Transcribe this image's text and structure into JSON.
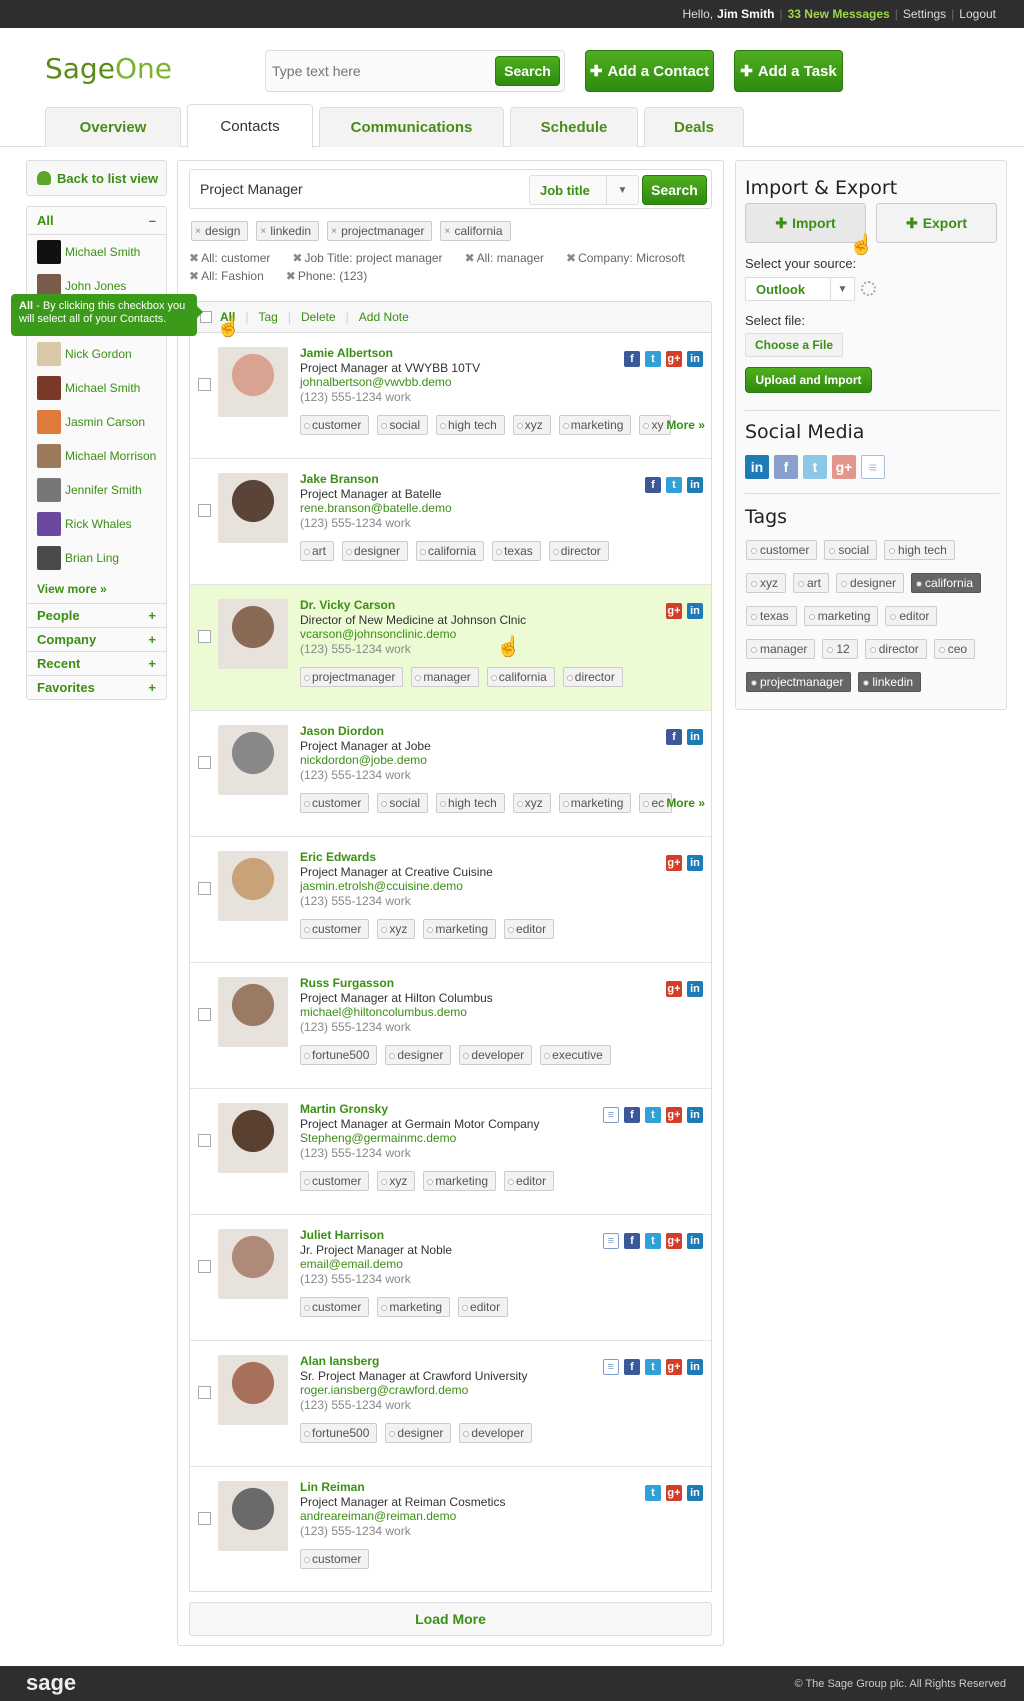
{
  "topbar": {
    "hello": "Hello,",
    "user": "Jim Smith",
    "messages": "33 New Messages",
    "settings": "Settings",
    "logout": "Logout"
  },
  "header": {
    "logo_sage": "Sage",
    "logo_one": "One",
    "search_placeholder": "Type text here",
    "search_button": "Search",
    "add_contact": "Add a Contact",
    "add_task": "Add a Task"
  },
  "tabs": [
    "Overview",
    "Contacts",
    "Communications",
    "Schedule",
    "Deals"
  ],
  "sidebar": {
    "back": "Back to list view",
    "all_label": "All",
    "all_toggle": "–",
    "contacts": [
      {
        "name": "Michael Smith",
        "color": "#111"
      },
      {
        "name": "John Jones",
        "color": "#7a5a4a"
      },
      {
        "name": "",
        "color": "#4a8c17"
      },
      {
        "name": "Nick Gordon",
        "color": "#d7c9a5"
      },
      {
        "name": "Michael Smith",
        "color": "#7a3a2a"
      },
      {
        "name": "Jasmin Carson",
        "color": "#e07a3a"
      },
      {
        "name": "Michael Morrison",
        "color": "#9a7a5a"
      },
      {
        "name": "Jennifer Smith",
        "color": "#777"
      },
      {
        "name": "Rick Whales",
        "color": "#6a4aa0"
      },
      {
        "name": "Brian Ling",
        "color": "#4a4a4a"
      }
    ],
    "view_more": "View more »",
    "categories": [
      {
        "label": "People",
        "sign": "+"
      },
      {
        "label": "Company",
        "sign": "+"
      },
      {
        "label": "Recent",
        "sign": "+"
      },
      {
        "label": "Favorites",
        "sign": "+"
      }
    ],
    "tooltip_bold": "All",
    "tooltip_text": " - By clicking this checkbox you will select all of your Contacts."
  },
  "main": {
    "query": "Project Manager",
    "field": "Job title",
    "search": "Search",
    "filter_tags": [
      "design",
      "linkedin",
      "projectmanager",
      "california"
    ],
    "filters": [
      "All: customer",
      "Job Title: project manager",
      "All: manager",
      "Company: Microsoft",
      "All: Fashion",
      "Phone: (123)"
    ],
    "actions": {
      "all": "All",
      "tag": "Tag",
      "delete": "Delete",
      "note": "Add Note"
    },
    "load_more": "Load More"
  },
  "contacts": [
    {
      "name": "Jamie Albertson",
      "role": "Project Manager",
      "at": "at",
      "company": "VWYBB 10TV",
      "email": "johnalbertson@vwvbb.demo",
      "phone": "(123) 555-1234 work",
      "tags": [
        "customer",
        "social",
        "high tech",
        "xyz",
        "marketing",
        "xy"
      ],
      "more": "More »",
      "social": [
        "fb",
        "tw",
        "gp",
        "li"
      ],
      "photo": "#d9a391",
      "highlight": false
    },
    {
      "name": "Jake Branson",
      "role": "Project Manager",
      "at": "at",
      "company": "Batelle",
      "email": "rene.branson@batelle.demo",
      "phone": "(123) 555-1234 work",
      "tags": [
        "art",
        "designer",
        "california",
        "texas",
        "director"
      ],
      "more": "",
      "social": [
        "fb",
        "tw",
        "li"
      ],
      "photo": "#5a4438",
      "highlight": false
    },
    {
      "name": "Dr. Vicky Carson",
      "role": "Director of New Medicine",
      "at": "at",
      "company": "Johnson Clnic",
      "email": "vcarson@johnsonclinic.demo",
      "phone": "(123) 555-1234 work",
      "tags": [
        "projectmanager",
        "manager",
        "california",
        "director"
      ],
      "more": "",
      "social": [
        "gp",
        "li"
      ],
      "photo": "#8a6a54",
      "highlight": true
    },
    {
      "name": "Jason Diordon",
      "role": "Project Manager",
      "at": "at",
      "company": "Jobe",
      "email": "nickdordon@jobe.demo",
      "phone": "(123) 555-1234 work",
      "tags": [
        "customer",
        "social",
        "high tech",
        "xyz",
        "marketing",
        "ec"
      ],
      "more": "More »",
      "social": [
        "fb",
        "li"
      ],
      "photo": "#888",
      "highlight": false
    },
    {
      "name": "Eric Edwards",
      "role": "Project Manager",
      "at": "at",
      "company": "Creative Cuisine",
      "email": "jasmin.etrolsh@ccuisine.demo",
      "phone": "(123) 555-1234 work",
      "tags": [
        "customer",
        "xyz",
        "marketing",
        "editor"
      ],
      "more": "",
      "social": [
        "gp",
        "li"
      ],
      "photo": "#c9a27a",
      "highlight": false
    },
    {
      "name": "Russ Furgasson",
      "role": "Project Manager",
      "at": "at",
      "company": "Hilton Columbus",
      "email": "michael@hiltoncolumbus.demo",
      "phone": "(123) 555-1234 work",
      "tags": [
        "fortune500",
        "designer",
        "developer",
        "executive"
      ],
      "more": "",
      "social": [
        "gp",
        "li"
      ],
      "photo": "#9a7a62",
      "highlight": false
    },
    {
      "name": "Martin Gronsky",
      "role": "Project Manager",
      "at": "at",
      "company": "Germain Motor Company",
      "email": "Stepheng@germainmc.demo",
      "phone": "(123) 555-1234 work",
      "tags": [
        "customer",
        "xyz",
        "marketing",
        "editor"
      ],
      "more": "",
      "social": [
        "nt",
        "fb",
        "tw",
        "gp",
        "li"
      ],
      "photo": "#5a4030",
      "highlight": false
    },
    {
      "name": "Juliet Harrison",
      "role": "Jr. Project Manager",
      "at": "at",
      "company": "Noble",
      "email": "email@email.demo",
      "phone": "(123) 555-1234 work",
      "tags": [
        "customer",
        "marketing",
        "editor"
      ],
      "more": "",
      "social": [
        "nt",
        "fb",
        "tw",
        "gp",
        "li"
      ],
      "photo": "#b08a78",
      "highlight": false
    },
    {
      "name": "Alan Iansberg",
      "role": "Sr. Project Manager",
      "at": "at",
      "company": "Crawford University",
      "email": "roger.iansberg@crawford.demo",
      "phone": "(123) 555-1234 work",
      "tags": [
        "fortune500",
        "designer",
        "developer"
      ],
      "more": "",
      "social": [
        "nt",
        "fb",
        "tw",
        "gp",
        "li"
      ],
      "photo": "#a8705a",
      "highlight": false
    },
    {
      "name": "Lin Reiman",
      "role": "Project Manager",
      "at": "at",
      "company": "Reiman Cosmetics",
      "email": "andreareiman@reiman.demo",
      "phone": "(123) 555-1234 work",
      "tags": [
        "customer"
      ],
      "more": "",
      "social": [
        "tw",
        "gp",
        "li"
      ],
      "photo": "#6a6a6a",
      "highlight": false
    }
  ],
  "right": {
    "ie_title": "Import & Export",
    "import": "Import",
    "export": "Export",
    "source_label": "Select your source:",
    "source": "Outlook",
    "file_label": "Select file:",
    "choose": "Choose a File",
    "upload": "Upload and Import",
    "social_title": "Social Media",
    "tags_title": "Tags",
    "tags": [
      {
        "t": "customer",
        "d": false
      },
      {
        "t": "social",
        "d": false
      },
      {
        "t": "high tech",
        "d": false
      },
      {
        "t": "xyz",
        "d": false
      },
      {
        "t": "art",
        "d": false
      },
      {
        "t": "designer",
        "d": false
      },
      {
        "t": "california",
        "d": true
      },
      {
        "t": "texas",
        "d": false
      },
      {
        "t": "marketing",
        "d": false
      },
      {
        "t": "editor",
        "d": false
      },
      {
        "t": "manager",
        "d": false
      },
      {
        "t": "12",
        "d": false
      },
      {
        "t": "director",
        "d": false
      },
      {
        "t": "ceo",
        "d": false
      },
      {
        "t": "projectmanager",
        "d": true
      },
      {
        "t": "linkedin",
        "d": true
      }
    ]
  },
  "footer": {
    "brand": "sage",
    "copy": "© The Sage Group plc. All Rights Reserved"
  },
  "icons": {
    "fb": "f",
    "tw": "t",
    "gp": "g+",
    "li": "in",
    "nt": "≡"
  }
}
